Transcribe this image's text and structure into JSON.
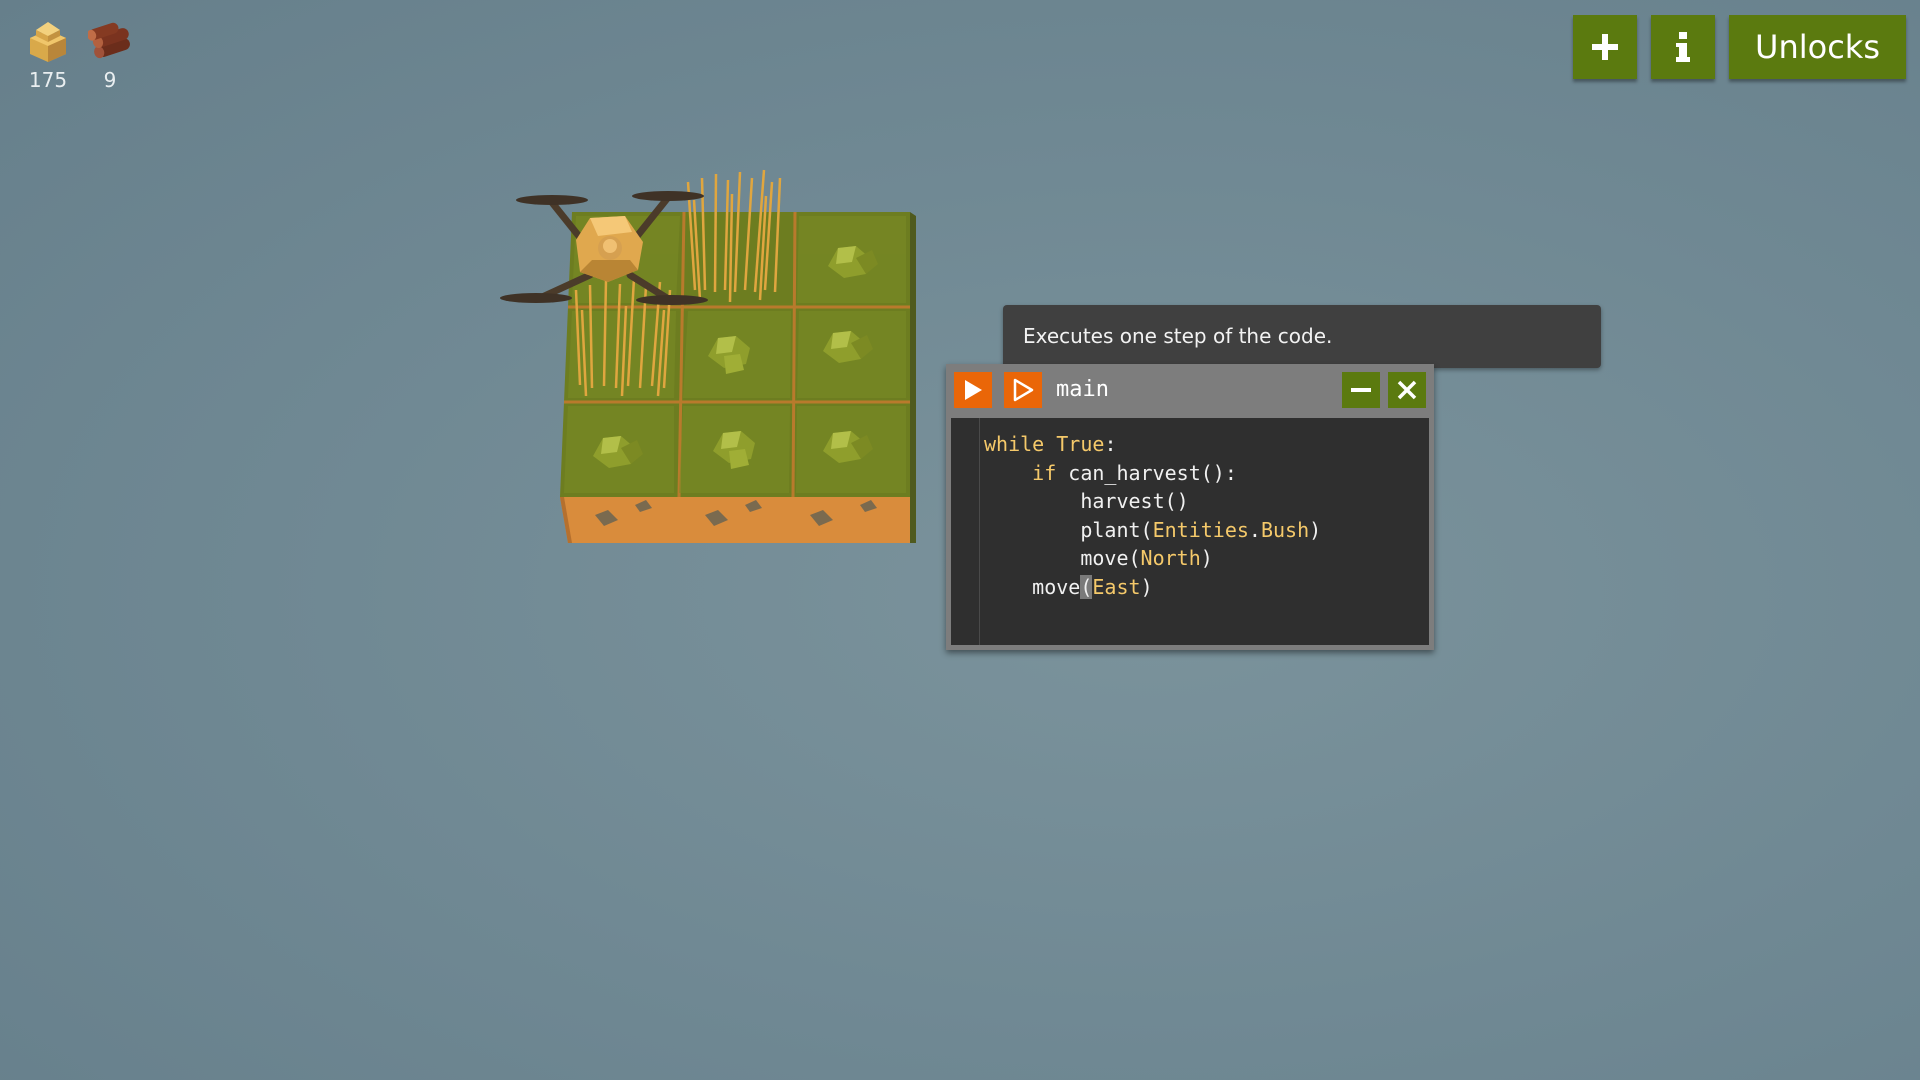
{
  "resources": [
    {
      "icon": "hay-icon",
      "count": "175"
    },
    {
      "icon": "wood-icon",
      "count": "9"
    }
  ],
  "top_buttons": {
    "add_icon": "plus-icon",
    "info_icon": "info-icon",
    "unlocks_label": "Unlocks"
  },
  "tooltip": {
    "text": "Executes one step of the code."
  },
  "code_window": {
    "title": "main",
    "lines": [
      {
        "indent": 0,
        "tokens": [
          {
            "t": "while",
            "c": "kw"
          },
          {
            "t": " "
          },
          {
            "t": "True",
            "c": "const"
          },
          {
            "t": ":"
          }
        ]
      },
      {
        "indent": 1,
        "tokens": [
          {
            "t": "if",
            "c": "kw"
          },
          {
            "t": " can_harvest():"
          }
        ]
      },
      {
        "indent": 2,
        "tokens": [
          {
            "t": "harvest()"
          }
        ]
      },
      {
        "indent": 2,
        "tokens": [
          {
            "t": "plant("
          },
          {
            "t": "Entities",
            "c": "const"
          },
          {
            "t": "."
          },
          {
            "t": "Bush",
            "c": "const"
          },
          {
            "t": ")"
          }
        ]
      },
      {
        "indent": 2,
        "tokens": [
          {
            "t": "move("
          },
          {
            "t": "North",
            "c": "const"
          },
          {
            "t": ")"
          }
        ]
      },
      {
        "indent": 1,
        "tokens": [
          {
            "t": "move"
          },
          {
            "t": "(",
            "c": "cursor"
          },
          {
            "t": "East",
            "c": "const"
          },
          {
            "t": ")"
          }
        ]
      }
    ]
  },
  "colors": {
    "accent_green": "#5b7a0f",
    "accent_orange": "#ea6608",
    "background": "#6f8893"
  }
}
